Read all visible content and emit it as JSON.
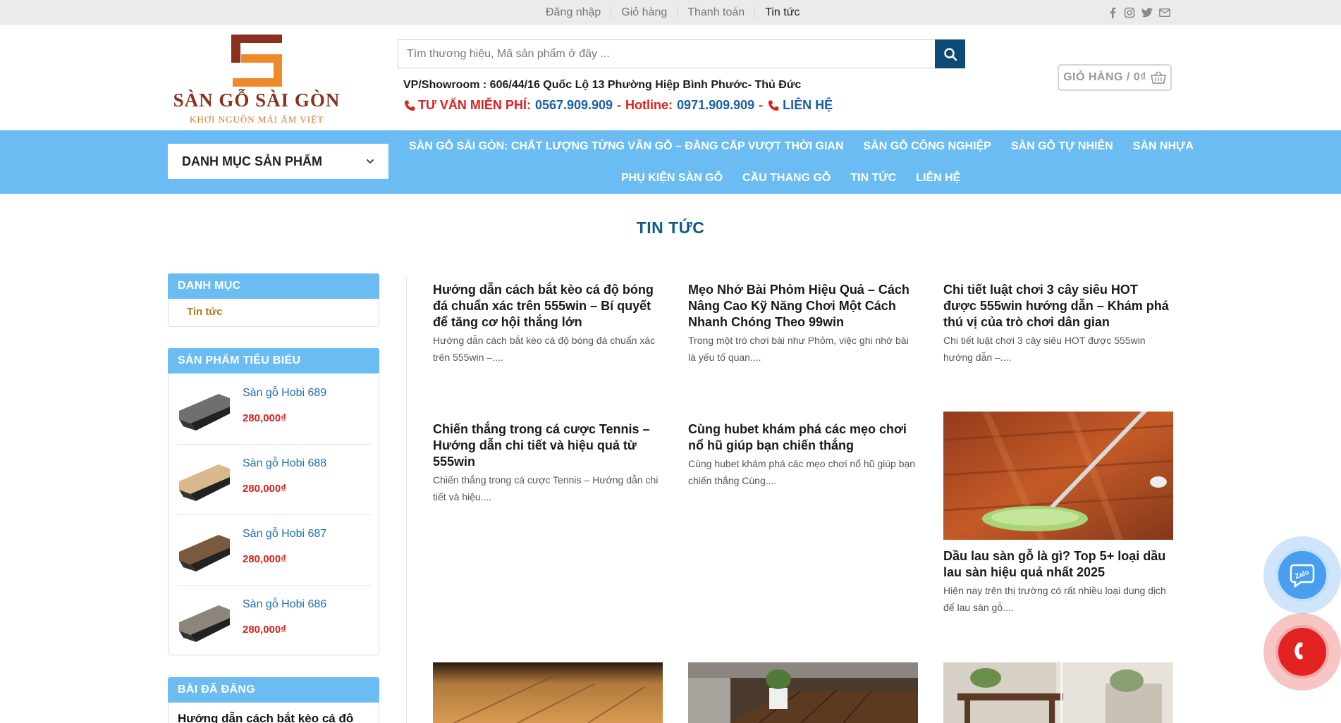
{
  "topbar": {
    "links": [
      {
        "label": "Đăng nhập"
      },
      {
        "label": "Giỏ hàng"
      },
      {
        "label": "Thanh toán"
      },
      {
        "label": "Tin tức"
      }
    ],
    "social_icons": [
      "facebook-icon",
      "instagram-icon",
      "twitter-icon",
      "email-icon"
    ]
  },
  "header": {
    "logo_text": "SÀN GỖ SÀI GÒN",
    "logo_slogan": "KHƠI NGUỒN MÁI ẤM VIỆT",
    "search_placeholder": "Tìm thương hiệu, Mã sản phẩm ở đây ...",
    "address": "VP/Showroom : 606/44/16 Quốc Lộ 13 Phường Hiệp Bình Phước- Thủ Đức",
    "hotline": {
      "consult_label": "TƯ VẤN MIỄN PHÍ:",
      "consult_number": "0567.909.909",
      "dash1": "-",
      "hotline_label": "Hotline:",
      "hotline_number": "0971.909.909",
      "dash2": "-",
      "contact_label": "LIÊN HỆ"
    },
    "cart_label": "GIỎ HÀNG / 0₫"
  },
  "nav": {
    "category_label": "DANH MỤC SẢN PHẨM",
    "row1": [
      "SÀN GỖ SÀI GÒN: CHẤT LƯỢNG TỪNG VÂN GỖ – ĐẲNG CẤP VƯỢT THỜI GIAN",
      "SÀN GỖ CÔNG NGHIỆP",
      "SÀN GỖ TỰ NHIÊN",
      "SÀN NHỰA"
    ],
    "row2": [
      "PHỤ KIỆN SÀN GỖ",
      "CẦU THANG GỖ",
      "TIN TỨC",
      "LIÊN HỆ"
    ]
  },
  "page_title": "TIN TỨC",
  "sidebar": {
    "categories": {
      "title": "DANH MỤC",
      "items": [
        "Tin tức"
      ]
    },
    "featured": {
      "title": "SẢN PHẨM TIÊU BIỂU",
      "products": [
        {
          "name": "Sàn gỗ Hobi 689",
          "price": "280,000₫",
          "color": "#6f6f6f"
        },
        {
          "name": "Sàn gỗ Hobi 688",
          "price": "280,000₫",
          "color": "#d9b98c"
        },
        {
          "name": "Sàn gỗ Hobi 687",
          "price": "280,000₫",
          "color": "#7a5a3f"
        },
        {
          "name": "Sàn gỗ Hobi 686",
          "price": "280,000₫",
          "color": "#8c857c"
        }
      ]
    },
    "posted": {
      "title": "BÀI ĐÃ ĐĂNG",
      "first_post": "Hướng dẫn cách bắt kèo cá độ"
    }
  },
  "posts": [
    {
      "title": "Hướng dẫn cách bắt kèo cá độ bóng đá chuẩn xác trên 555win – Bí quyết để tăng cơ hội thắng lớn",
      "excerpt": "  Hướng dẫn cách bắt kèo cá độ bóng đá chuẩn xác trên 555win –...."
    },
    {
      "title": "Mẹo Nhớ Bài Phỏm Hiệu Quả – Cách Nâng Cao Kỹ Năng Chơi Một Cách Nhanh Chóng Theo 99win",
      "excerpt": "Trong một trò chơi bài như Phỏm, việc ghi nhớ bài là yếu tố quan...."
    },
    {
      "title": "Chi tiết luật chơi 3 cây siêu HOT được 555win hướng dẫn – Khám phá thú vị của trò chơi dân gian",
      "excerpt": "  Chi tiết luật chơi 3 cây siêu HOT được 555win hướng dẫn –...."
    },
    {
      "title": "Chiến thắng trong cá cược Tennis – Hướng dẫn chi tiết và hiệu quả từ 555win",
      "excerpt": "  Chiến thắng trong cá cược Tennis – Hướng dẫn chi tiết và hiệu...."
    },
    {
      "title": "Cùng hubet khám phá các mẹo chơi nổ hũ giúp bạn chiến thắng",
      "excerpt": "  Cùng hubet khám phá các mẹo chơi nổ hũ giúp bạn chiến thắng Cùng...."
    },
    {
      "title": "Dầu lau sàn gỗ là gì? Top 5+ loại dầu lau sàn hiệu quả nhất 2025",
      "excerpt": "Hiện nay trên thị trường có rất nhiều loại dung dịch để lau sàn gỗ...."
    }
  ],
  "floating": {
    "zalo_label": "Zalo"
  }
}
